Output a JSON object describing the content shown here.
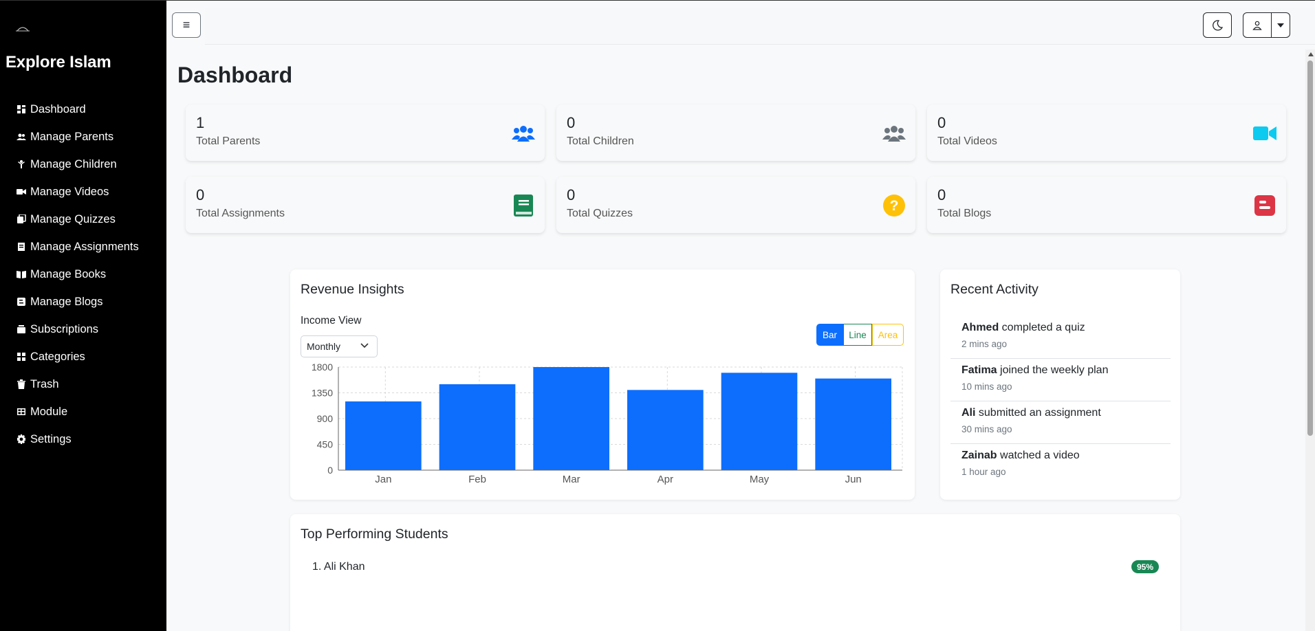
{
  "sidebar": {
    "brand": "Explore Islam",
    "items": [
      {
        "label": "Dashboard",
        "icon": "dashboard-icon"
      },
      {
        "label": "Manage Parents",
        "icon": "users-icon"
      },
      {
        "label": "Manage Children",
        "icon": "child-icon"
      },
      {
        "label": "Manage Videos",
        "icon": "video-icon"
      },
      {
        "label": "Manage Quizzes",
        "icon": "quiz-icon"
      },
      {
        "label": "Manage Assignments",
        "icon": "assignment-icon"
      },
      {
        "label": "Manage Books",
        "icon": "book-icon"
      },
      {
        "label": "Manage Blogs",
        "icon": "blog-icon"
      },
      {
        "label": "Subscriptions",
        "icon": "subscription-icon"
      },
      {
        "label": "Categories",
        "icon": "categories-icon"
      },
      {
        "label": "Trash",
        "icon": "trash-icon"
      },
      {
        "label": "Module",
        "icon": "module-icon"
      },
      {
        "label": "Settings",
        "icon": "gear-icon"
      }
    ]
  },
  "topbar": {
    "menu_glyph": "≡",
    "icons": [
      "moon-icon",
      "user-icon",
      "caret-down-icon"
    ]
  },
  "page": {
    "title": "Dashboard"
  },
  "stats": [
    {
      "value": "1",
      "label": "Total Parents",
      "icon": "users-icon",
      "color": "#0d6efd"
    },
    {
      "value": "0",
      "label": "Total Children",
      "icon": "users-icon",
      "color": "#6c757d"
    },
    {
      "value": "0",
      "label": "Total Videos",
      "icon": "video-icon",
      "color": "#0dcaf0"
    },
    {
      "value": "0",
      "label": "Total Assignments",
      "icon": "book-icon",
      "color": "#198754"
    },
    {
      "value": "0",
      "label": "Total Quizzes",
      "icon": "question-icon",
      "color": "#ffc107"
    },
    {
      "value": "0",
      "label": "Total Blogs",
      "icon": "blog-icon",
      "color": "#dc3545"
    }
  ],
  "revenue": {
    "title": "Revenue Insights",
    "income_label": "Income View",
    "period_selected": "Monthly",
    "chart_types": [
      "Bar",
      "Line",
      "Area"
    ],
    "active_type": "Bar"
  },
  "chart_data": {
    "type": "bar",
    "categories": [
      "Jan",
      "Feb",
      "Mar",
      "Apr",
      "May",
      "Jun"
    ],
    "values": [
      1200,
      1500,
      1800,
      1400,
      1700,
      1600
    ],
    "yticks": [
      0,
      450,
      900,
      1350,
      1800
    ],
    "ylim": [
      0,
      1800
    ],
    "title": "",
    "xlabel": "",
    "ylabel": "",
    "grid": true,
    "color": "#0d6efd"
  },
  "activity": {
    "title": "Recent Activity",
    "items": [
      {
        "name": "Ahmed",
        "action": " completed a quiz",
        "time": "2 mins ago"
      },
      {
        "name": "Fatima",
        "action": " joined the weekly plan",
        "time": "10 mins ago"
      },
      {
        "name": "Ali",
        "action": " submitted an assignment",
        "time": "30 mins ago"
      },
      {
        "name": "Zainab",
        "action": " watched a video",
        "time": "1 hour ago"
      }
    ]
  },
  "top_students": {
    "title": "Top Performing Students",
    "items": [
      {
        "label": "1. Ali Khan",
        "score": "95%"
      }
    ]
  }
}
